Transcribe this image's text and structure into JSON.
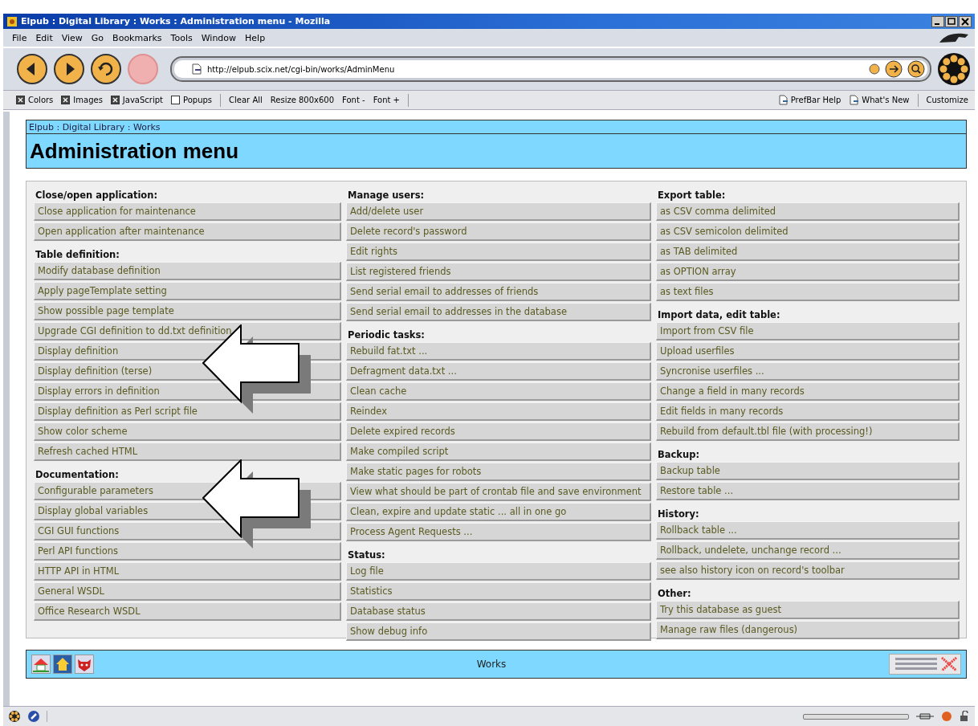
{
  "window": {
    "title": "Elpub : Digital Library : Works : Administration menu - Mozilla"
  },
  "menu": [
    "File",
    "Edit",
    "View",
    "Go",
    "Bookmarks",
    "Tools",
    "Window",
    "Help"
  ],
  "nav_buttons": [
    {
      "kind": "back",
      "disabled": false
    },
    {
      "kind": "forward",
      "disabled": false
    },
    {
      "kind": "reload",
      "disabled": false
    },
    {
      "kind": "stop",
      "disabled": true
    }
  ],
  "address": {
    "value": "http://elpub.scix.net/cgi-bin/works/AdminMenu"
  },
  "prefbar": {
    "checkboxes": [
      {
        "label": "Colors",
        "checked": true
      },
      {
        "label": "Images",
        "checked": true
      },
      {
        "label": "JavaScript",
        "checked": true
      },
      {
        "label": "Popups",
        "checked": false
      }
    ],
    "buttons": [
      "Clear All",
      "Resize 800x600",
      "Font -",
      "Font +"
    ],
    "links": [
      "PrefBar Help",
      "What's New"
    ],
    "customize": "Customize"
  },
  "page": {
    "breadcrumb": "Elpub : Digital Library : Works",
    "heading": "Administration menu",
    "columns": [
      [
        {
          "heading": "Close/open application:",
          "items": [
            "Close application for maintenance",
            "Open application after maintenance"
          ]
        },
        {
          "heading": "Table definition:",
          "items": [
            "Modify database definition",
            "Apply pageTemplate setting",
            "Show possible page template",
            "Upgrade CGI definition to dd.txt definition",
            "Display definition",
            "Display definition (terse)",
            "Display errors in definition",
            "Display definition as Perl script file",
            "Show color scheme",
            "Refresh cached HTML"
          ]
        },
        {
          "heading": "Documentation:",
          "items": [
            "Configurable parameters",
            "Display global variables",
            "CGI GUI functions",
            "Perl API functions",
            "HTTP API in HTML",
            "General WSDL",
            "Office Research WSDL"
          ]
        }
      ],
      [
        {
          "heading": "Manage users:",
          "items": [
            "Add/delete user",
            "Delete record's password",
            "Edit rights",
            "List registered friends",
            "Send serial email to addresses of friends",
            "Send serial email to addresses in the database"
          ]
        },
        {
          "heading": "Periodic tasks:",
          "items": [
            "Rebuild fat.txt ...",
            "Defragment data.txt ...",
            "Clean cache",
            "Reindex",
            "Delete expired records",
            "Make compiled script",
            "Make static pages for robots",
            "View what should be part of crontab file and save environment",
            "Clean, expire and update static ... all in one go",
            "Process Agent Requests ..."
          ]
        },
        {
          "heading": "Status:",
          "items": [
            "Log file",
            "Statistics",
            "Database status",
            "Show debug info"
          ]
        }
      ],
      [
        {
          "heading": "Export table:",
          "items": [
            "as CSV comma delimited",
            "as CSV semicolon delimited",
            "as TAB delimited",
            "as OPTION array",
            "as text files"
          ]
        },
        {
          "heading": "Import data, edit table:",
          "items": [
            "Import from CSV file",
            "Upload userfiles",
            "Syncronise userfiles ...",
            "Change a field in many records",
            "Edit fields in many records",
            "Rebuild from default.tbl file (with processing!)"
          ]
        },
        {
          "heading": "Backup:",
          "items": [
            "Backup table",
            "Restore table ..."
          ]
        },
        {
          "heading": "History:",
          "items": [
            "Rollback table ...",
            "Rollback, undelete, unchange record ...",
            "see also history icon on record's toolbar"
          ]
        },
        {
          "heading": "Other:",
          "items": [
            "Try this database as guest",
            "Manage raw files (dangerous)"
          ]
        }
      ]
    ],
    "footer": {
      "title": "Works"
    }
  }
}
